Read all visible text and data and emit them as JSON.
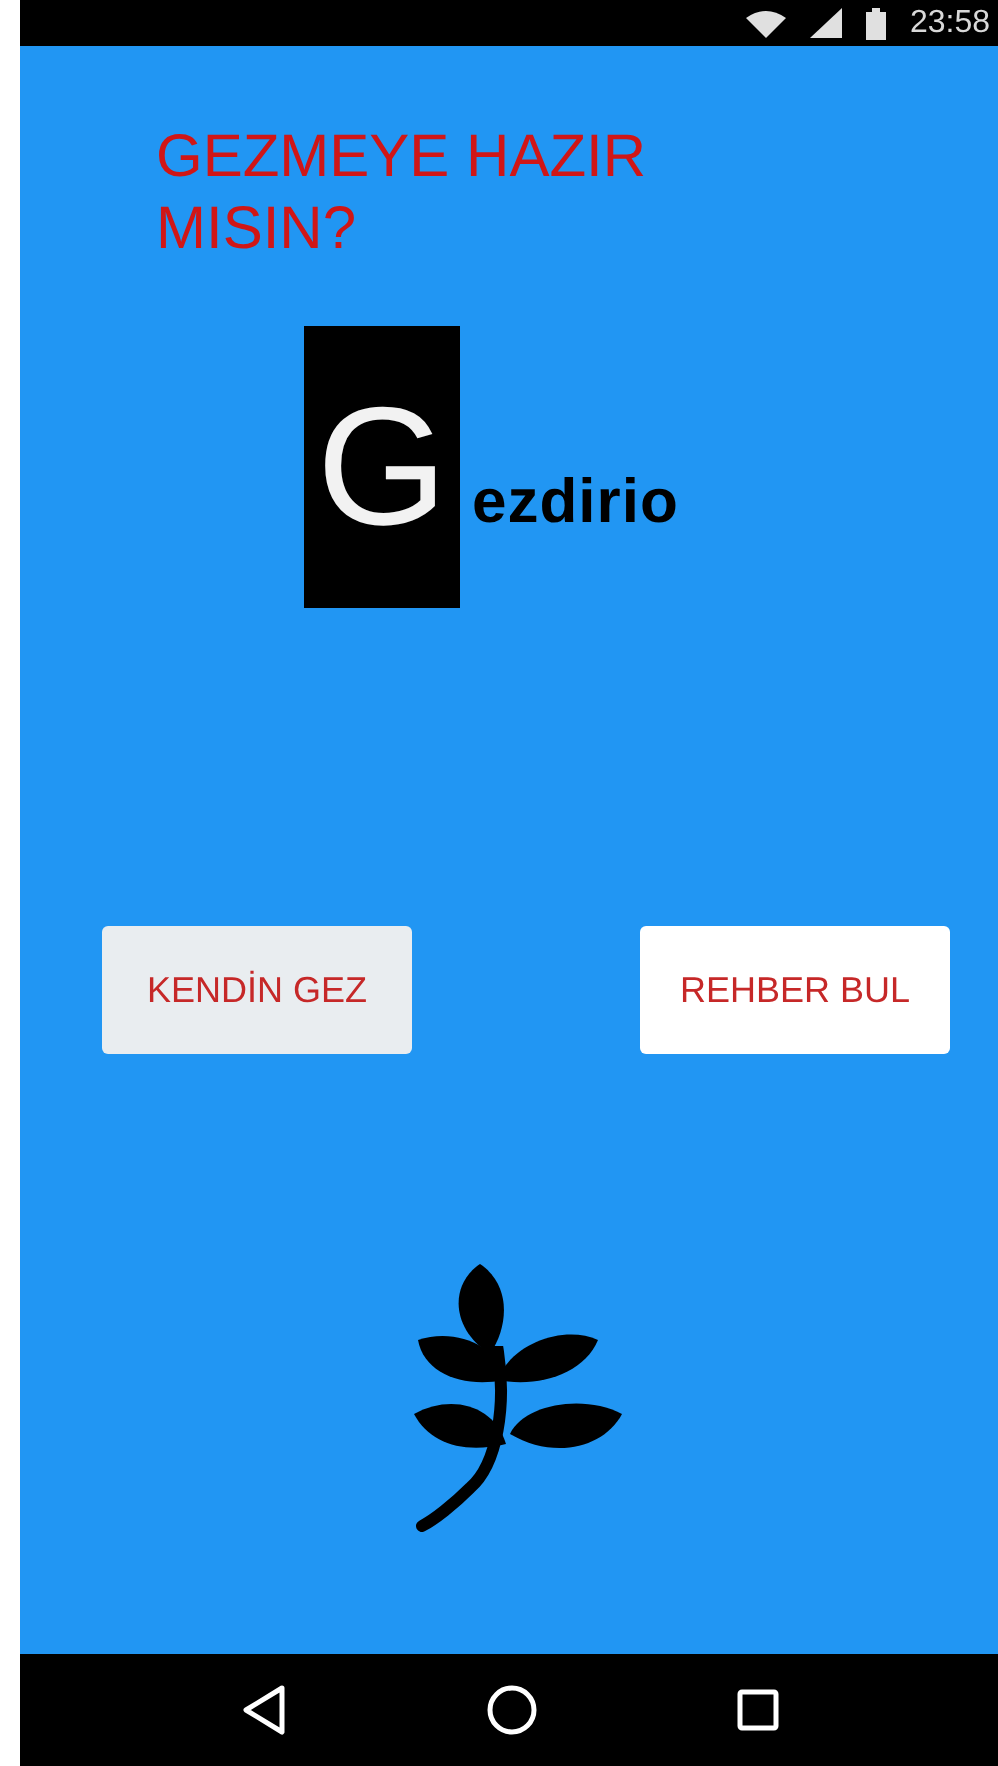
{
  "status_bar": {
    "time": "23:58"
  },
  "title": "GEZMEYE HAZIR MISIN?",
  "logo": {
    "initial": "G",
    "rest": "ezdirio"
  },
  "buttons": [
    {
      "label": "KENDİN GEZ",
      "pressed": true
    },
    {
      "label": "REHBER BUL",
      "pressed": false
    }
  ]
}
